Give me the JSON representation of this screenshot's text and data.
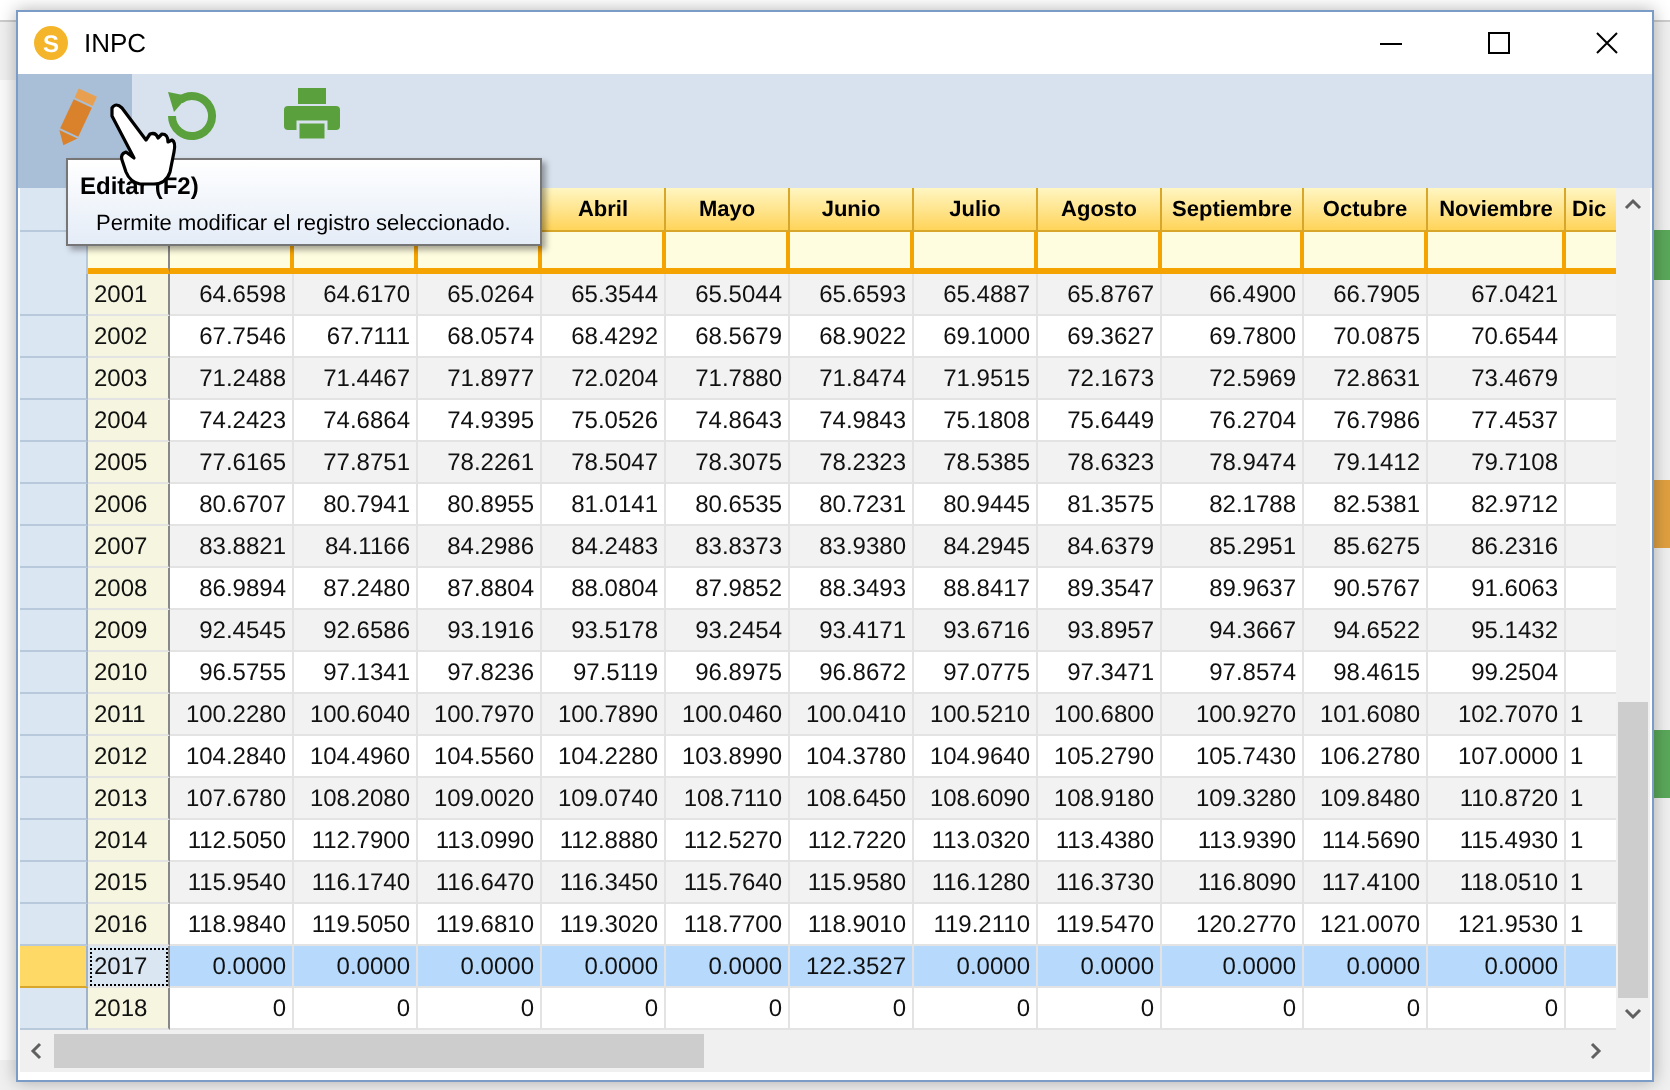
{
  "window": {
    "title": "INPC",
    "app_icon_letter": "S"
  },
  "toolbar": {
    "buttons": [
      {
        "kind": "edit",
        "highlighted": true
      },
      {
        "kind": "refresh",
        "highlighted": false
      },
      {
        "kind": "print",
        "highlighted": false
      }
    ]
  },
  "tooltip": {
    "title": "Editar (F2)",
    "text": "Permite modificar el registro seleccionado."
  },
  "table": {
    "columns": [
      "",
      "",
      "",
      "",
      "Abril",
      "Mayo",
      "Junio",
      "Julio",
      "Agosto",
      "Septiembre",
      "Octubre",
      "Noviembre",
      "Dic"
    ],
    "rows": [
      {
        "selected": false,
        "cells": [
          "2001",
          "64.6598",
          "64.6170",
          "65.0264",
          "65.3544",
          "65.5044",
          "65.6593",
          "65.4887",
          "65.8767",
          "66.4900",
          "66.7905",
          "67.0421"
        ]
      },
      {
        "selected": false,
        "cells": [
          "2002",
          "67.7546",
          "67.7111",
          "68.0574",
          "68.4292",
          "68.5679",
          "68.9022",
          "69.1000",
          "69.3627",
          "69.7800",
          "70.0875",
          "70.6544"
        ]
      },
      {
        "selected": false,
        "cells": [
          "2003",
          "71.2488",
          "71.4467",
          "71.8977",
          "72.0204",
          "71.7880",
          "71.8474",
          "71.9515",
          "72.1673",
          "72.5969",
          "72.8631",
          "73.4679"
        ]
      },
      {
        "selected": false,
        "cells": [
          "2004",
          "74.2423",
          "74.6864",
          "74.9395",
          "75.0526",
          "74.8643",
          "74.9843",
          "75.1808",
          "75.6449",
          "76.2704",
          "76.7986",
          "77.4537"
        ]
      },
      {
        "selected": false,
        "cells": [
          "2005",
          "77.6165",
          "77.8751",
          "78.2261",
          "78.5047",
          "78.3075",
          "78.2323",
          "78.5385",
          "78.6323",
          "78.9474",
          "79.1412",
          "79.7108"
        ]
      },
      {
        "selected": false,
        "cells": [
          "2006",
          "80.6707",
          "80.7941",
          "80.8955",
          "81.0141",
          "80.6535",
          "80.7231",
          "80.9445",
          "81.3575",
          "82.1788",
          "82.5381",
          "82.9712"
        ]
      },
      {
        "selected": false,
        "cells": [
          "2007",
          "83.8821",
          "84.1166",
          "84.2986",
          "84.2483",
          "83.8373",
          "83.9380",
          "84.2945",
          "84.6379",
          "85.2951",
          "85.6275",
          "86.2316"
        ]
      },
      {
        "selected": false,
        "cells": [
          "2008",
          "86.9894",
          "87.2480",
          "87.8804",
          "88.0804",
          "87.9852",
          "88.3493",
          "88.8417",
          "89.3547",
          "89.9637",
          "90.5767",
          "91.6063"
        ]
      },
      {
        "selected": false,
        "cells": [
          "2009",
          "92.4545",
          "92.6586",
          "93.1916",
          "93.5178",
          "93.2454",
          "93.4171",
          "93.6716",
          "93.8957",
          "94.3667",
          "94.6522",
          "95.1432"
        ]
      },
      {
        "selected": false,
        "cells": [
          "2010",
          "96.5755",
          "97.1341",
          "97.8236",
          "97.5119",
          "96.8975",
          "96.8672",
          "97.0775",
          "97.3471",
          "97.8574",
          "98.4615",
          "99.2504"
        ]
      },
      {
        "selected": false,
        "cells": [
          "2011",
          "100.2280",
          "100.6040",
          "100.7970",
          "100.7890",
          "100.0460",
          "100.0410",
          "100.5210",
          "100.6800",
          "100.9270",
          "101.6080",
          "102.7070",
          "1"
        ]
      },
      {
        "selected": false,
        "cells": [
          "2012",
          "104.2840",
          "104.4960",
          "104.5560",
          "104.2280",
          "103.8990",
          "104.3780",
          "104.9640",
          "105.2790",
          "105.7430",
          "106.2780",
          "107.0000",
          "1"
        ]
      },
      {
        "selected": false,
        "cells": [
          "2013",
          "107.6780",
          "108.2080",
          "109.0020",
          "109.0740",
          "108.7110",
          "108.6450",
          "108.6090",
          "108.9180",
          "109.3280",
          "109.8480",
          "110.8720",
          "1"
        ]
      },
      {
        "selected": false,
        "cells": [
          "2014",
          "112.5050",
          "112.7900",
          "113.0990",
          "112.8880",
          "112.5270",
          "112.7220",
          "113.0320",
          "113.4380",
          "113.9390",
          "114.5690",
          "115.4930",
          "1"
        ]
      },
      {
        "selected": false,
        "cells": [
          "2015",
          "115.9540",
          "116.1740",
          "116.6470",
          "116.3450",
          "115.7640",
          "115.9580",
          "116.1280",
          "116.3730",
          "116.8090",
          "117.4100",
          "118.0510",
          "1"
        ]
      },
      {
        "selected": false,
        "cells": [
          "2016",
          "118.9840",
          "119.5050",
          "119.6810",
          "119.3020",
          "118.7700",
          "118.9010",
          "119.2110",
          "119.5470",
          "120.2770",
          "121.0070",
          "121.9530",
          "1"
        ]
      },
      {
        "selected": true,
        "cells": [
          "2017",
          "0.0000",
          "0.0000",
          "0.0000",
          "0.0000",
          "0.0000",
          "122.3527",
          "0.0000",
          "0.0000",
          "0.0000",
          "0.0000",
          "0.0000"
        ]
      },
      {
        "selected": false,
        "cells": [
          "2018",
          "0",
          "0",
          "0",
          "0",
          "0",
          "0",
          "0",
          "0",
          "0",
          "0",
          "0"
        ]
      }
    ]
  }
}
